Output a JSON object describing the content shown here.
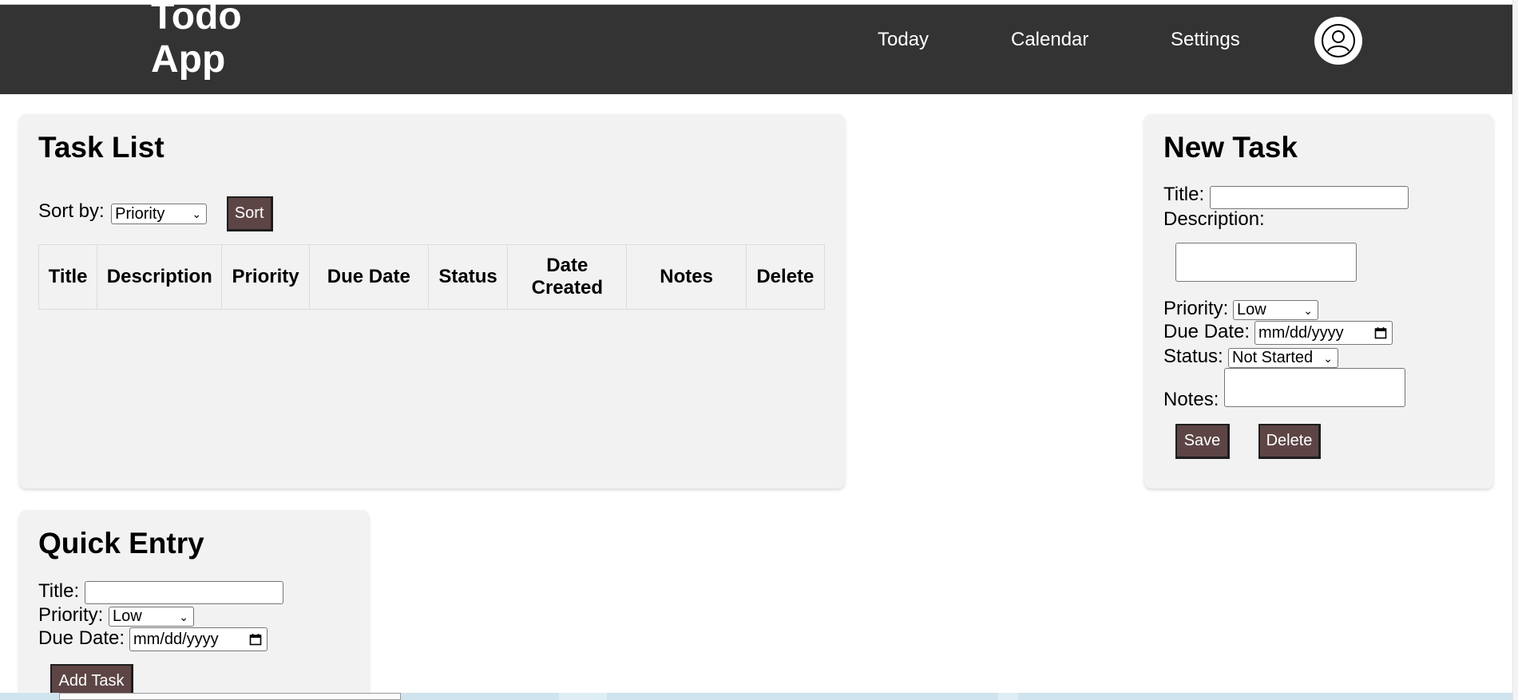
{
  "navbar": {
    "brand_line1": "Todo",
    "brand_line2": "App",
    "links": [
      "Today",
      "Calendar",
      "Settings"
    ],
    "avatar_icon": "user-circle-icon",
    "background": "#333333"
  },
  "task_list": {
    "title": "Task List",
    "sort_label": "Sort by:",
    "sort_selected": "Priority",
    "sort_button": "Sort",
    "columns": [
      "Title",
      "Description",
      "Priority",
      "Due Date",
      "Status",
      "Date Created",
      "Notes",
      "Delete"
    ]
  },
  "new_task": {
    "title": "New Task",
    "title_label": "Title:",
    "description_label": "Description:",
    "priority_label": "Priority:",
    "priority_selected": "Low",
    "due_date_label": "Due Date:",
    "due_date_placeholder": "mm/dd/yyyy",
    "status_label": "Status:",
    "status_selected": "Not Started",
    "notes_label": "Notes:",
    "save_button": "Save",
    "delete_button": "Delete"
  },
  "quick_entry": {
    "title": "Quick Entry",
    "title_label": "Title:",
    "priority_label": "Priority:",
    "priority_selected": "Low",
    "due_date_label": "Due Date:",
    "due_date_placeholder": "mm/dd/yyyy",
    "add_button": "Add Task"
  },
  "colors": {
    "button_bg": "#5d4545",
    "panel_bg": "#f2f2f2"
  }
}
